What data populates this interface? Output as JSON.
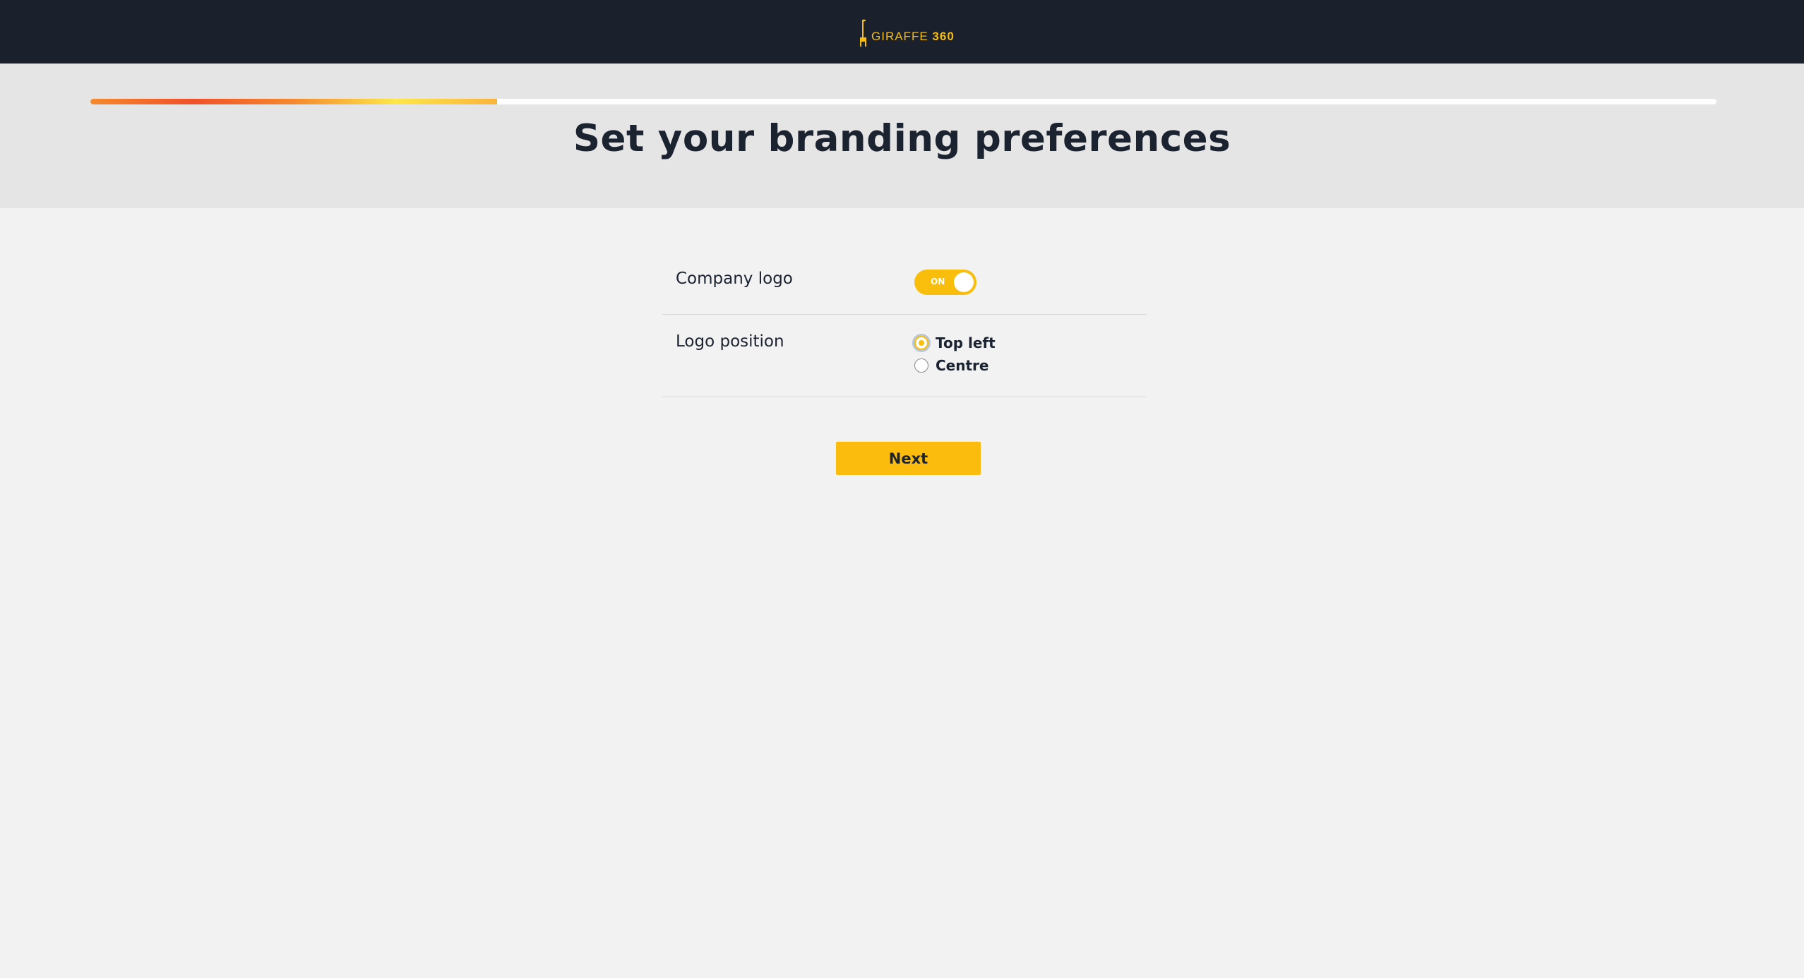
{
  "header": {
    "brand_name": "GIRAFFE",
    "brand_number": "360",
    "logo_icon": "giraffe-icon"
  },
  "progress": {
    "fraction": 0.25
  },
  "page": {
    "title": "Set your branding preferences"
  },
  "form": {
    "company_logo": {
      "label": "Company logo",
      "toggle_text": "ON",
      "enabled": true
    },
    "logo_position": {
      "label": "Logo position",
      "options": [
        {
          "label": "Top left",
          "selected": true
        },
        {
          "label": "Centre",
          "selected": false
        }
      ]
    }
  },
  "actions": {
    "next_label": "Next"
  },
  "colors": {
    "accent": "#fcbc0e",
    "topbar": "#1b202d",
    "header_band": "#e5e5e5",
    "background": "#f2f2f2",
    "text": "#1b2230"
  }
}
